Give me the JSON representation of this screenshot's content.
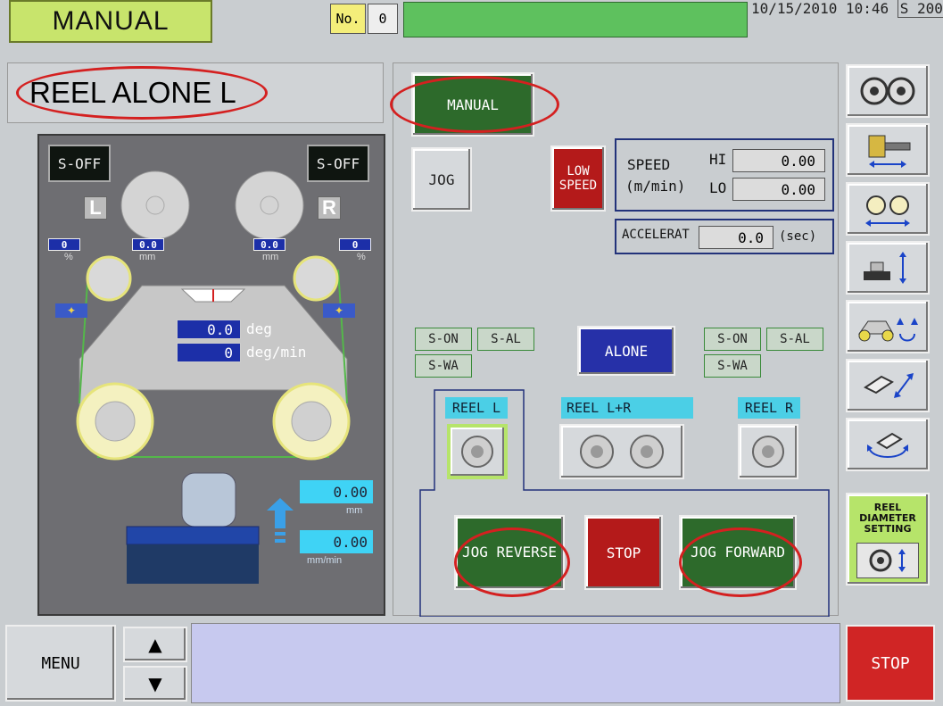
{
  "header": {
    "mode": "MANUAL",
    "no_label": "No.",
    "no_value": "0",
    "datetime": "10/15/2010 10:46",
    "id_fragment": "S 200"
  },
  "left": {
    "mode_title": "REEL ALONE L",
    "servo_l": "S-OFF",
    "servo_r": "S-OFF",
    "side_l": "L",
    "side_r": "R",
    "pct_l": "0",
    "pct_r": "0",
    "pct_unit": "%",
    "dia_l": "0.0",
    "dia_r": "0.0",
    "mm_unit": "mm",
    "angle_value": "0.0",
    "angle_unit": "deg",
    "speed_value": "0",
    "speed_unit": "deg/min",
    "pos_value": "0.00",
    "pos_unit": "mm",
    "vel_value": "0.00",
    "vel_unit": "mm/min"
  },
  "control": {
    "manual_btn": "MANUAL",
    "jog_btn": "JOG",
    "low_speed_btn": "LOW SPEED",
    "speed_label": "SPEED",
    "speed_unit": "(m/min)",
    "hi_label": "HI",
    "hi_value": "0.00",
    "lo_label": "LO",
    "lo_value": "0.00",
    "accel_label": "ACCELERAT",
    "accel_value": "0.0",
    "accel_unit": "(sec)",
    "left_status": {
      "s_on": "S-ON",
      "s_al": "S-AL",
      "s_wa": "S-WA"
    },
    "right_status": {
      "s_on": "S-ON",
      "s_al": "S-AL",
      "s_wa": "S-WA"
    },
    "alone_btn": "ALONE",
    "reel_l": "REEL L",
    "reel_lr": "REEL L+R",
    "reel_r": "REEL R",
    "jog_reverse": "JOG REVERSE",
    "stop": "STOP",
    "jog_forward": "JOG FORWARD"
  },
  "side_icons": [
    {
      "name": "two-reels-icon"
    },
    {
      "name": "reel-shift-icon"
    },
    {
      "name": "reel-pair-move-icon"
    },
    {
      "name": "lift-icon"
    },
    {
      "name": "carriage-icon"
    },
    {
      "name": "diagonal-move-icon"
    },
    {
      "name": "rotate-icon"
    }
  ],
  "reel_diameter": "REEL DIAMETER SETTING",
  "footer": {
    "menu": "MENU",
    "up": "▲",
    "down": "▼",
    "stop": "STOP"
  },
  "colors": {
    "mode_green": "#c8e46c",
    "status_green": "#5ec15e",
    "button_green": "#2d6a2b",
    "stop_red": "#d02525",
    "blue_field": "#1c2fa8",
    "cyan_field": "#3fd3f5",
    "highlight_ring": "#d42020"
  }
}
